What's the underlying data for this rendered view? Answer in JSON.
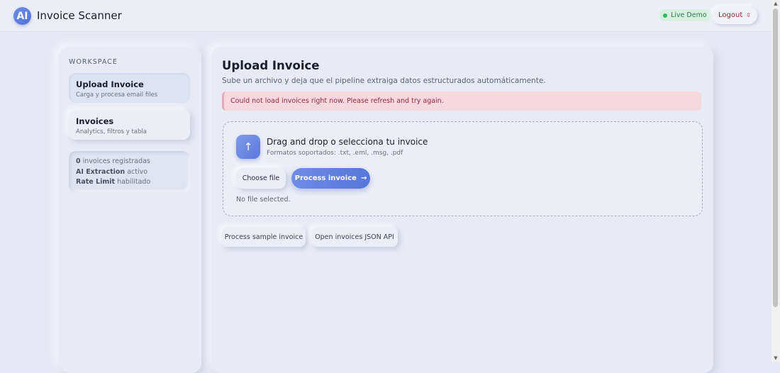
{
  "header": {
    "logo_text": "AI",
    "app_title": "Invoice Scanner",
    "live_badge": "Live Demo",
    "logout_label": "Logout",
    "logout_icon": "⇳"
  },
  "sidebar": {
    "workspace_label": "WORKSPACE",
    "items": [
      {
        "title": "Upload Invoice",
        "subtitle": "Carga y procesa email files",
        "active": true
      },
      {
        "title": "Invoices",
        "subtitle": "Analytics, filtros y tabla",
        "active": false
      }
    ],
    "stats": {
      "count": "0",
      "count_text": "invoices registradas",
      "ai_label": "AI Extraction",
      "ai_status": "activo",
      "rate_label": "Rate Limit",
      "rate_status": "habilitado"
    }
  },
  "main": {
    "title": "Upload Invoice",
    "subtitle": "Sube un archivo y deja que el pipeline extraiga datos estructurados automáticamente.",
    "error": "Could not load invoices right now. Please refresh and try again.",
    "dropzone": {
      "icon": "↑",
      "title": "Drag and drop o selecciona tu invoice",
      "formats": "Formatos soportados: .txt, .eml, .msg, .pdf",
      "choose_label": "Choose file",
      "process_label": "Process invoice",
      "process_arrow": "→",
      "no_file": "No file selected."
    },
    "sample_label": "Process sample invoice",
    "api_label": "Open invoices JSON API"
  },
  "colors": {
    "accent": "#5b78da",
    "live_green": "#2dbb5c",
    "error_text": "#8e2b3d",
    "error_bg": "#f6d8de"
  }
}
